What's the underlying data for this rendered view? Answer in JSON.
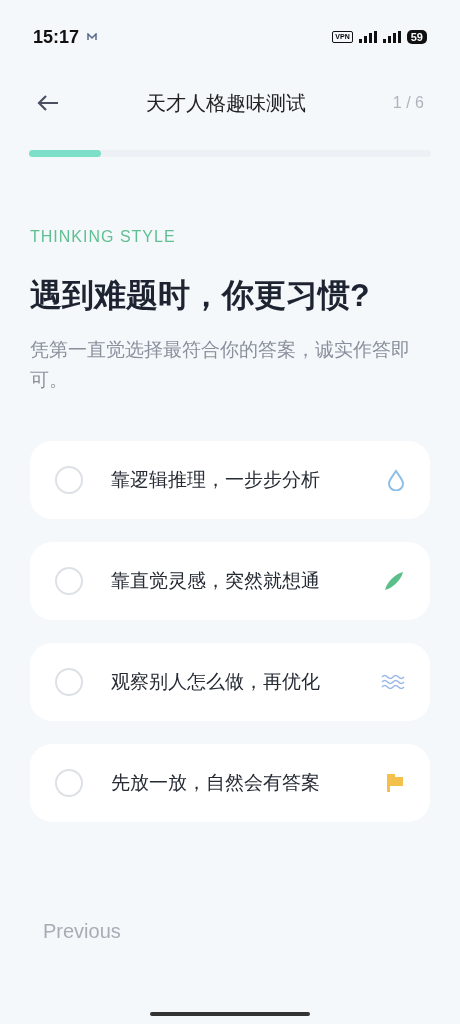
{
  "status_bar": {
    "time": "15:17",
    "vpn": "VPN",
    "battery": "59"
  },
  "header": {
    "title": "天才人格趣味测试",
    "step": "1 / 6"
  },
  "progress": {
    "level": 0.18
  },
  "section_label": "THINKING STYLE",
  "question": "遇到难题时，你更习惯?",
  "hint": "凭第一直觉选择最符合你的答案，诚实作答即可。",
  "options": [
    {
      "label": "靠逻辑推理，一步步分析",
      "selected": false
    },
    {
      "label": "靠直觉灵感，突然就想通",
      "selected": false
    },
    {
      "label": "观察别人怎么做，再优化",
      "selected": false
    },
    {
      "label": "先放一放，自然会有答案",
      "selected": false
    }
  ],
  "previous": "Previous"
}
